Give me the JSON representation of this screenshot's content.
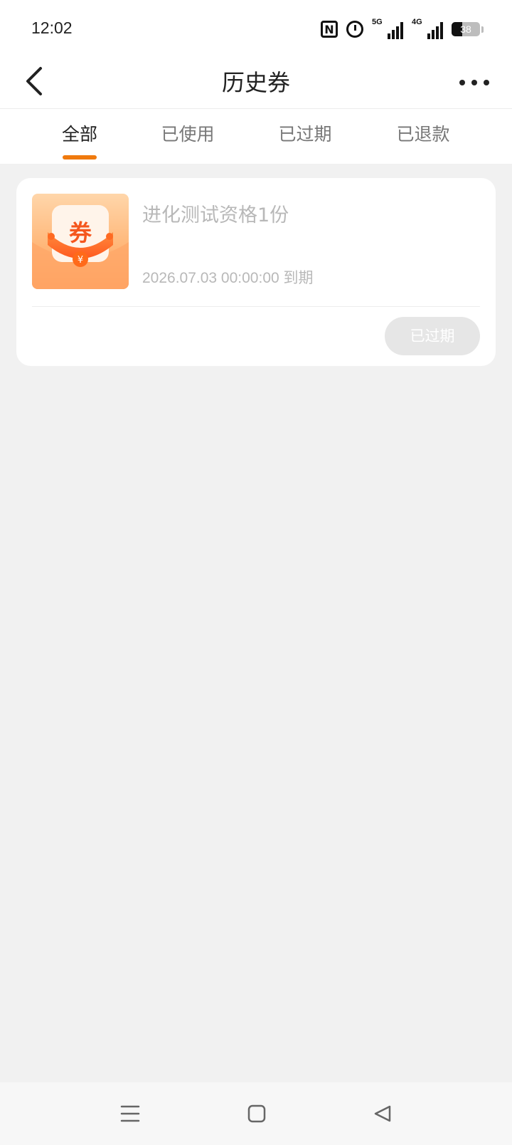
{
  "status_bar": {
    "time": "12:02",
    "signal_5g_label": "5G",
    "signal_4g_label": "4G",
    "battery_level": "38",
    "battery_fraction": 0.38
  },
  "header": {
    "title": "历史券"
  },
  "tabs": [
    {
      "label": "全部",
      "active": true
    },
    {
      "label": "已使用",
      "active": false
    },
    {
      "label": "已过期",
      "active": false
    },
    {
      "label": "已退款",
      "active": false
    }
  ],
  "coupon": {
    "icon_text": "券",
    "name": "进化测试资格1份",
    "expiry": "2026.07.03 00:00:00 到期",
    "status_label": "已过期"
  },
  "colors": {
    "accent": "#f07a0e",
    "muted_text": "#b8b8b8",
    "disabled_button": "#e6e6e6"
  }
}
